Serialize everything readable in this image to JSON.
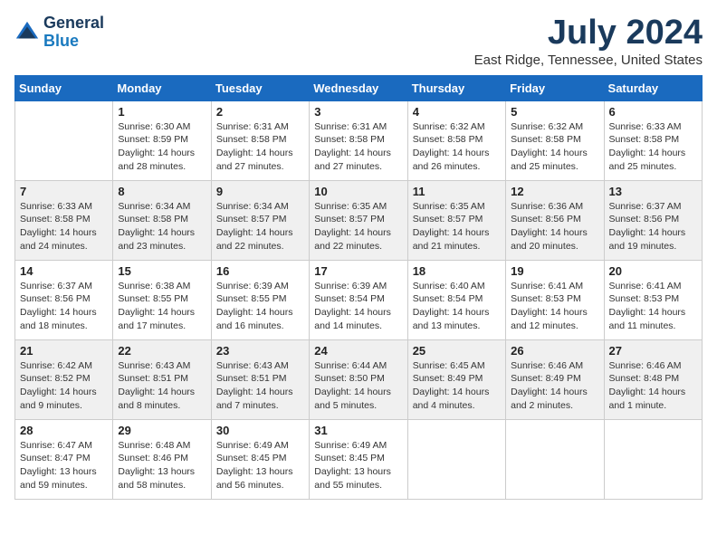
{
  "logo": {
    "line1": "General",
    "line2": "Blue"
  },
  "title": "July 2024",
  "location": "East Ridge, Tennessee, United States",
  "weekdays": [
    "Sunday",
    "Monday",
    "Tuesday",
    "Wednesday",
    "Thursday",
    "Friday",
    "Saturday"
  ],
  "weeks": [
    [
      {
        "day": "",
        "sunrise": "",
        "sunset": "",
        "daylight": ""
      },
      {
        "day": "1",
        "sunrise": "Sunrise: 6:30 AM",
        "sunset": "Sunset: 8:59 PM",
        "daylight": "Daylight: 14 hours and 28 minutes."
      },
      {
        "day": "2",
        "sunrise": "Sunrise: 6:31 AM",
        "sunset": "Sunset: 8:58 PM",
        "daylight": "Daylight: 14 hours and 27 minutes."
      },
      {
        "day": "3",
        "sunrise": "Sunrise: 6:31 AM",
        "sunset": "Sunset: 8:58 PM",
        "daylight": "Daylight: 14 hours and 27 minutes."
      },
      {
        "day": "4",
        "sunrise": "Sunrise: 6:32 AM",
        "sunset": "Sunset: 8:58 PM",
        "daylight": "Daylight: 14 hours and 26 minutes."
      },
      {
        "day": "5",
        "sunrise": "Sunrise: 6:32 AM",
        "sunset": "Sunset: 8:58 PM",
        "daylight": "Daylight: 14 hours and 25 minutes."
      },
      {
        "day": "6",
        "sunrise": "Sunrise: 6:33 AM",
        "sunset": "Sunset: 8:58 PM",
        "daylight": "Daylight: 14 hours and 25 minutes."
      }
    ],
    [
      {
        "day": "7",
        "sunrise": "Sunrise: 6:33 AM",
        "sunset": "Sunset: 8:58 PM",
        "daylight": "Daylight: 14 hours and 24 minutes."
      },
      {
        "day": "8",
        "sunrise": "Sunrise: 6:34 AM",
        "sunset": "Sunset: 8:58 PM",
        "daylight": "Daylight: 14 hours and 23 minutes."
      },
      {
        "day": "9",
        "sunrise": "Sunrise: 6:34 AM",
        "sunset": "Sunset: 8:57 PM",
        "daylight": "Daylight: 14 hours and 22 minutes."
      },
      {
        "day": "10",
        "sunrise": "Sunrise: 6:35 AM",
        "sunset": "Sunset: 8:57 PM",
        "daylight": "Daylight: 14 hours and 22 minutes."
      },
      {
        "day": "11",
        "sunrise": "Sunrise: 6:35 AM",
        "sunset": "Sunset: 8:57 PM",
        "daylight": "Daylight: 14 hours and 21 minutes."
      },
      {
        "day": "12",
        "sunrise": "Sunrise: 6:36 AM",
        "sunset": "Sunset: 8:56 PM",
        "daylight": "Daylight: 14 hours and 20 minutes."
      },
      {
        "day": "13",
        "sunrise": "Sunrise: 6:37 AM",
        "sunset": "Sunset: 8:56 PM",
        "daylight": "Daylight: 14 hours and 19 minutes."
      }
    ],
    [
      {
        "day": "14",
        "sunrise": "Sunrise: 6:37 AM",
        "sunset": "Sunset: 8:56 PM",
        "daylight": "Daylight: 14 hours and 18 minutes."
      },
      {
        "day": "15",
        "sunrise": "Sunrise: 6:38 AM",
        "sunset": "Sunset: 8:55 PM",
        "daylight": "Daylight: 14 hours and 17 minutes."
      },
      {
        "day": "16",
        "sunrise": "Sunrise: 6:39 AM",
        "sunset": "Sunset: 8:55 PM",
        "daylight": "Daylight: 14 hours and 16 minutes."
      },
      {
        "day": "17",
        "sunrise": "Sunrise: 6:39 AM",
        "sunset": "Sunset: 8:54 PM",
        "daylight": "Daylight: 14 hours and 14 minutes."
      },
      {
        "day": "18",
        "sunrise": "Sunrise: 6:40 AM",
        "sunset": "Sunset: 8:54 PM",
        "daylight": "Daylight: 14 hours and 13 minutes."
      },
      {
        "day": "19",
        "sunrise": "Sunrise: 6:41 AM",
        "sunset": "Sunset: 8:53 PM",
        "daylight": "Daylight: 14 hours and 12 minutes."
      },
      {
        "day": "20",
        "sunrise": "Sunrise: 6:41 AM",
        "sunset": "Sunset: 8:53 PM",
        "daylight": "Daylight: 14 hours and 11 minutes."
      }
    ],
    [
      {
        "day": "21",
        "sunrise": "Sunrise: 6:42 AM",
        "sunset": "Sunset: 8:52 PM",
        "daylight": "Daylight: 14 hours and 9 minutes."
      },
      {
        "day": "22",
        "sunrise": "Sunrise: 6:43 AM",
        "sunset": "Sunset: 8:51 PM",
        "daylight": "Daylight: 14 hours and 8 minutes."
      },
      {
        "day": "23",
        "sunrise": "Sunrise: 6:43 AM",
        "sunset": "Sunset: 8:51 PM",
        "daylight": "Daylight: 14 hours and 7 minutes."
      },
      {
        "day": "24",
        "sunrise": "Sunrise: 6:44 AM",
        "sunset": "Sunset: 8:50 PM",
        "daylight": "Daylight: 14 hours and 5 minutes."
      },
      {
        "day": "25",
        "sunrise": "Sunrise: 6:45 AM",
        "sunset": "Sunset: 8:49 PM",
        "daylight": "Daylight: 14 hours and 4 minutes."
      },
      {
        "day": "26",
        "sunrise": "Sunrise: 6:46 AM",
        "sunset": "Sunset: 8:49 PM",
        "daylight": "Daylight: 14 hours and 2 minutes."
      },
      {
        "day": "27",
        "sunrise": "Sunrise: 6:46 AM",
        "sunset": "Sunset: 8:48 PM",
        "daylight": "Daylight: 14 hours and 1 minute."
      }
    ],
    [
      {
        "day": "28",
        "sunrise": "Sunrise: 6:47 AM",
        "sunset": "Sunset: 8:47 PM",
        "daylight": "Daylight: 13 hours and 59 minutes."
      },
      {
        "day": "29",
        "sunrise": "Sunrise: 6:48 AM",
        "sunset": "Sunset: 8:46 PM",
        "daylight": "Daylight: 13 hours and 58 minutes."
      },
      {
        "day": "30",
        "sunrise": "Sunrise: 6:49 AM",
        "sunset": "Sunset: 8:45 PM",
        "daylight": "Daylight: 13 hours and 56 minutes."
      },
      {
        "day": "31",
        "sunrise": "Sunrise: 6:49 AM",
        "sunset": "Sunset: 8:45 PM",
        "daylight": "Daylight: 13 hours and 55 minutes."
      },
      {
        "day": "",
        "sunrise": "",
        "sunset": "",
        "daylight": ""
      },
      {
        "day": "",
        "sunrise": "",
        "sunset": "",
        "daylight": ""
      },
      {
        "day": "",
        "sunrise": "",
        "sunset": "",
        "daylight": ""
      }
    ]
  ]
}
